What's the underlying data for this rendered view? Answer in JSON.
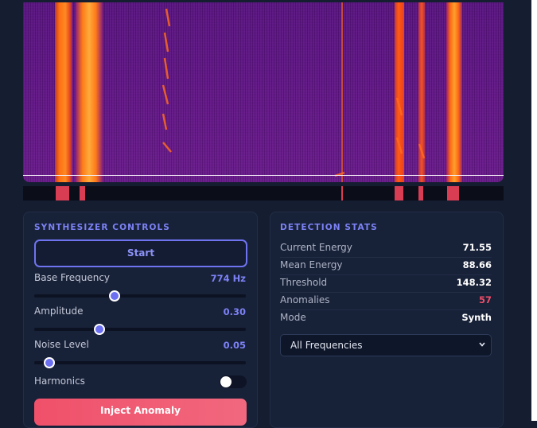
{
  "synth": {
    "title": "SYNTHESIZER CONTROLS",
    "start_label": "Start",
    "base_frequency": {
      "label": "Base Frequency",
      "value": "774 Hz",
      "level": 0.38
    },
    "amplitude": {
      "label": "Amplitude",
      "value": "0.30",
      "level": 0.31
    },
    "noise": {
      "label": "Noise Level",
      "value": "0.05",
      "level": 0.07
    },
    "harmonics": {
      "label": "Harmonics",
      "on": false
    },
    "inject_label": "Inject Anomaly"
  },
  "stats": {
    "title": "DETECTION STATS",
    "rows": [
      {
        "label": "Current Energy",
        "value": "71.55"
      },
      {
        "label": "Mean Energy",
        "value": "88.66"
      },
      {
        "label": "Threshold",
        "value": "148.32"
      },
      {
        "label": "Anomalies",
        "value": "57"
      },
      {
        "label": "Mode",
        "value": "Synth"
      }
    ],
    "filter_selected": "All Frequencies"
  },
  "colors": {
    "accent": "#7c82f5",
    "alert": "#f04e68",
    "spectrogram_bg": "#5b1483",
    "spectrogram_hot": "#ff7a1a"
  },
  "icons": {
    "select": "chevron-down-icon"
  }
}
